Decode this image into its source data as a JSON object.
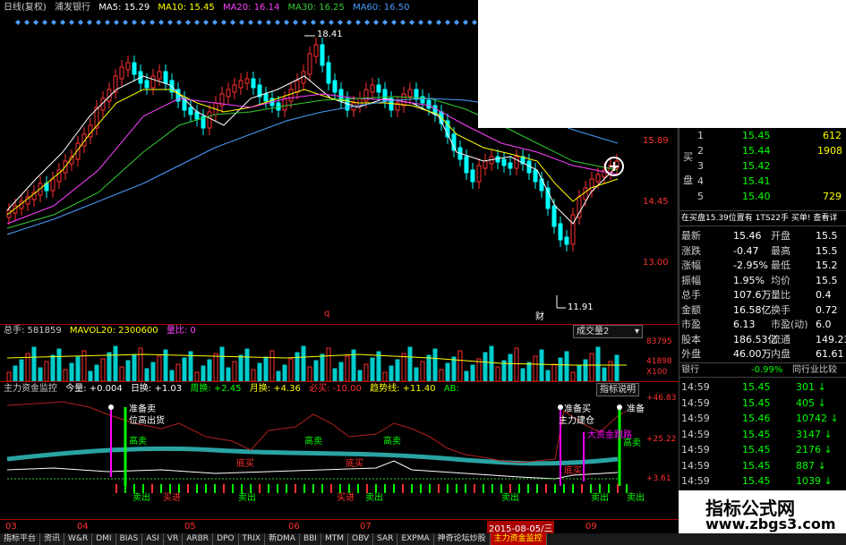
{
  "main_chart": {
    "header": {
      "title": "日线(复权)",
      "stock": "浦发银行",
      "ma5_label": "MA5: 15.29",
      "ma10_label": "MA10: 15.45",
      "ma20_label": "MA20: 16.14",
      "ma30_label": "MA30: 16.25",
      "ma60_label": "MA60: 16.50"
    },
    "price_labels": {
      "p1": "15.89",
      "p2": "14.45",
      "p3": "13.00"
    },
    "high_label": "18.41",
    "low_label": "11.91",
    "mark_q": "q",
    "mark_cai": "财"
  },
  "volume_panel": {
    "label": "总手: 581859",
    "mavol": "MAVOL20: 2300600",
    "ratio": "量比: 0",
    "select": "成交量2",
    "y1": "83795",
    "y2": "41898",
    "y3": "X100"
  },
  "indicator_panel": {
    "title": "主力资金监控",
    "items": [
      "今量: +0.004",
      "日换: +1.03",
      "周换: +2.45",
      "月换: +4.36",
      "必买: -10.00",
      "趋势线: +11.40",
      "AB:"
    ],
    "button": "指标说明",
    "y1": "+46.83",
    "y2": "+25.22",
    "y3": "+3.61",
    "annotations": {
      "a1": "准备卖",
      "a2": "位高出货",
      "a3": "高卖",
      "a4": "高卖",
      "a5": "高卖",
      "a6": "底买",
      "a7": "底买",
      "a8": "准备买",
      "a9": "主力建仓",
      "a10": "大资金跑路",
      "a11": "准备",
      "a12": "高卖",
      "a13": "底买",
      "b1": "卖出",
      "b2": "买进",
      "b3": "卖出",
      "b4": "买进",
      "b5": "卖出",
      "b6": "卖出",
      "b7": "卖出",
      "b8": "卖出"
    }
  },
  "x_axis": [
    "03",
    "04",
    "05",
    "06",
    "07",
    "09"
  ],
  "x_date": "2015-08-05/三",
  "right_panel": {
    "buy_label": "买盘",
    "buy_rows": [
      {
        "n": "1",
        "price": "15.45",
        "vol": "612"
      },
      {
        "n": "2",
        "price": "15.44",
        "vol": "1908"
      },
      {
        "n": "3",
        "price": "15.42",
        "vol": ""
      },
      {
        "n": "4",
        "price": "15.41",
        "vol": ""
      },
      {
        "n": "5",
        "price": "15.40",
        "vol": "729"
      }
    ],
    "info_bar": "在买盘15.39位置有 1TS22手 买单! 查看详",
    "stats": [
      {
        "l": "最新",
        "v": "15.46",
        "l2": "开盘",
        "v2": "15.5"
      },
      {
        "l": "涨跌",
        "v": "-0.47",
        "l2": "最高",
        "v2": "15.5"
      },
      {
        "l": "涨幅",
        "v": "-2.95%",
        "l2": "最低",
        "v2": "15.2"
      },
      {
        "l": "振幅",
        "v": "1.95%",
        "l2": "均价",
        "v2": "15.5"
      },
      {
        "l": "总手",
        "v": "107.6万",
        "l2": "量比",
        "v2": "0.4"
      },
      {
        "l": "金额",
        "v": "16.58亿",
        "l2": "换手",
        "v2": "0.72"
      },
      {
        "l": "市盈",
        "v": "6.13",
        "l2": "市盈(动)",
        "v2": "6.0"
      },
      {
        "l": "股本",
        "v": "186.53亿",
        "l2": "流通",
        "v2": "149.23"
      },
      {
        "l": "外盘",
        "v": "46.00万",
        "l2": "内盘",
        "v2": "61.61"
      }
    ],
    "sector_label": "银行",
    "sector_change": "-0.99%",
    "sector_btn": "同行业比较",
    "ticks": [
      {
        "t": "14:59",
        "p": "15.45",
        "v": "301"
      },
      {
        "t": "14:59",
        "p": "15.45",
        "v": "405"
      },
      {
        "t": "14:59",
        "p": "15.46",
        "v": "10742"
      },
      {
        "t": "14:59",
        "p": "15.45",
        "v": "3147"
      },
      {
        "t": "14:59",
        "p": "15.45",
        "v": "2176"
      },
      {
        "t": "14:59",
        "p": "15.45",
        "v": "887"
      },
      {
        "t": "14:59",
        "p": "15.45",
        "v": "1039"
      }
    ]
  },
  "watermark": {
    "title": "指标公式网",
    "url": "www.zbgs3.com"
  },
  "tabs": [
    "指标平台",
    "资讯",
    "W&R",
    "DMI",
    "BIAS",
    "ASI",
    "VR",
    "ARBR",
    "DPO",
    "TRIX",
    "新DMA",
    "BBI",
    "MTM",
    "OBV",
    "SAR",
    "EXPMA",
    "神奇论坛炒股",
    "主力资金监控"
  ],
  "colors": {
    "up": "#ff3030",
    "down": "#00ffff",
    "yellow": "#ffff00",
    "green": "#00ff00",
    "magenta": "#ff00ff"
  }
}
